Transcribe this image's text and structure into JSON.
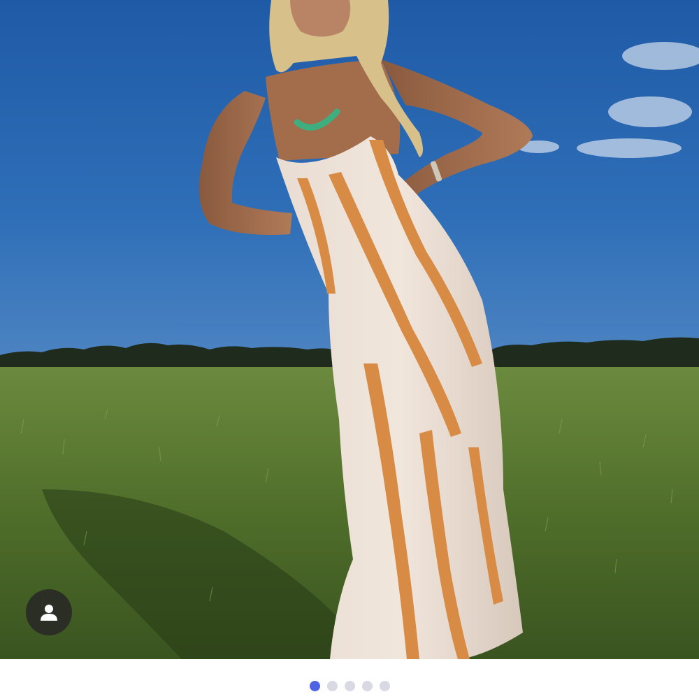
{
  "gallery": {
    "image_alt": "",
    "dots": [
      {
        "active": true
      },
      {
        "active": false
      },
      {
        "active": false
      },
      {
        "active": false
      },
      {
        "active": false
      }
    ],
    "active_index": 0
  },
  "icons": {
    "tag_button": "person-icon"
  },
  "colors": {
    "active_dot": "#4f63e6",
    "inactive_dot": "#d9d9e3",
    "tag_button_bg": "#2a2a28"
  }
}
